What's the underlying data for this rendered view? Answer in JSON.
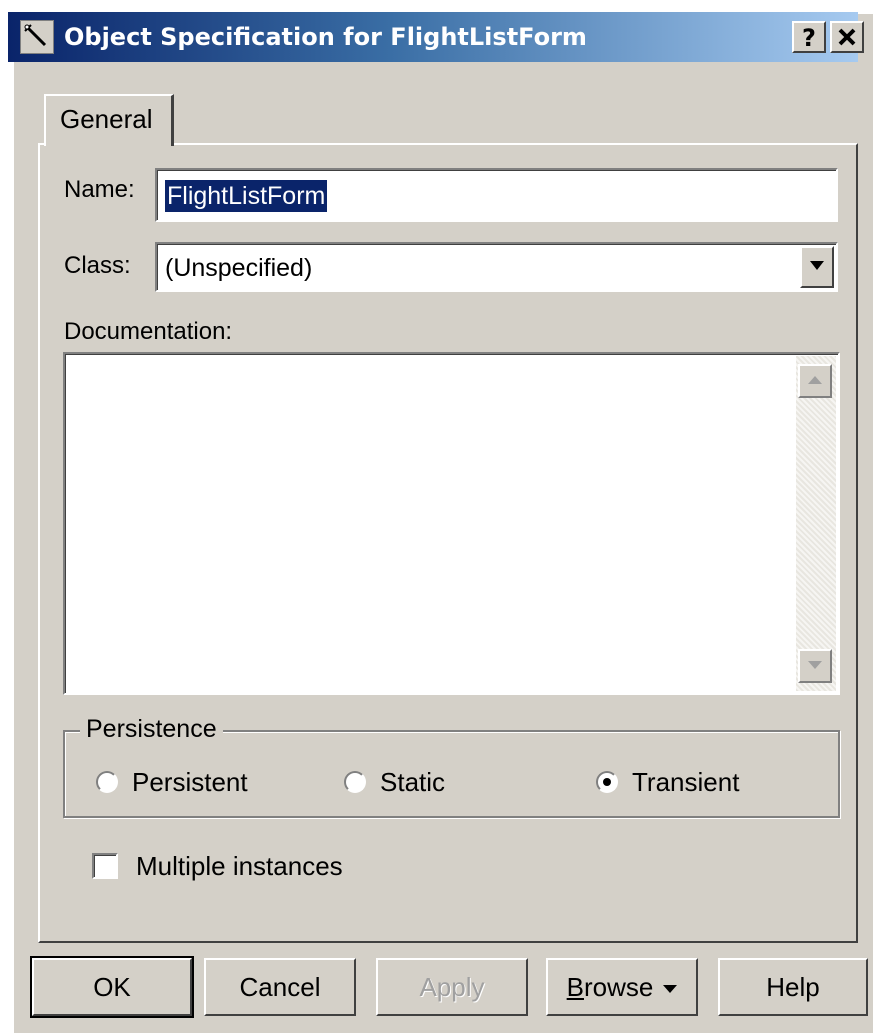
{
  "window": {
    "title": "Object Specification for FlightListForm",
    "help_button": "?",
    "icons": {
      "app": "magnifier-wand-icon",
      "close": "close-icon"
    }
  },
  "tabs": [
    {
      "label": "General",
      "active": true
    }
  ],
  "form": {
    "name_label": "Name:",
    "name_value": "FlightListForm",
    "class_label": "Class:",
    "class_value": "(Unspecified)",
    "documentation_label": "Documentation:",
    "documentation_value": ""
  },
  "persistence": {
    "title": "Persistence",
    "options": [
      {
        "label": "Persistent",
        "selected": false
      },
      {
        "label": "Static",
        "selected": false
      },
      {
        "label": "Transient",
        "selected": true
      }
    ]
  },
  "multiple_instances": {
    "label": "Multiple instances",
    "checked": false
  },
  "buttons": {
    "ok": "OK",
    "cancel": "Cancel",
    "apply": "Apply",
    "browse_underlined": "B",
    "browse_rest": "rowse",
    "help": "Help"
  },
  "colors": {
    "face": "#d4d0c8",
    "title_gradient_start": "#0a246a",
    "title_gradient_end": "#a6caf0",
    "selection": "#0a246a"
  }
}
